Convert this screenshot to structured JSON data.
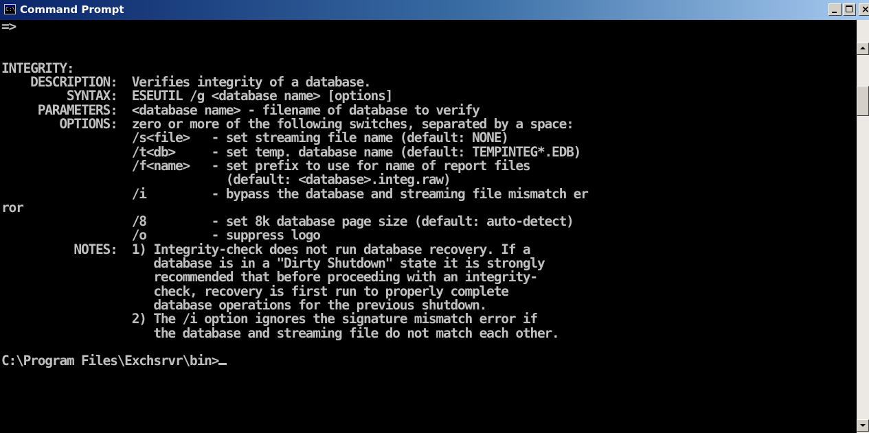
{
  "window": {
    "title": "Command Prompt",
    "icon": "command-prompt-icon",
    "icon_text": "C:\\",
    "controls": {
      "minimize": "minimize-icon",
      "maximize": "maximize-icon",
      "close": "close-icon",
      "close_glyph": "×"
    }
  },
  "colors": {
    "background": "#000000",
    "text": "#c0c0c0",
    "titlebar_start": "#0a246a",
    "titlebar_end": "#a6caf0"
  },
  "console": {
    "lines": [
      "=>",
      "",
      "",
      "INTEGRITY:",
      "    DESCRIPTION:  Verifies integrity of a database.",
      "         SYNTAX:  ESEUTIL /g <database name> [options]",
      "     PARAMETERS:  <database name> - filename of database to verify",
      "        OPTIONS:  zero or more of the following switches, separated by a space:",
      "                  /s<file>   - set streaming file name (default: NONE)",
      "                  /t<db>     - set temp. database name (default: TEMPINTEG*.EDB)",
      "                  /f<name>   - set prefix to use for name of report files",
      "                               (default: <database>.integ.raw)",
      "                  /i         - bypass the database and streaming file mismatch er",
      "ror",
      "                  /8         - set 8k database page size (default: auto-detect)",
      "                  /o         - suppress logo",
      "          NOTES:  1) Integrity-check does not run database recovery. If a",
      "                     database is in a \"Dirty Shutdown\" state it is strongly",
      "                     recommended that before proceeding with an integrity-",
      "                     check, recovery is first run to properly complete",
      "                     database operations for the previous shutdown.",
      "                  2) The /i option ignores the signature mismatch error if",
      "                     the database and streaming file do not match each other.",
      ""
    ],
    "prompt": "C:\\Program Files\\Exchsrvr\\bin>"
  },
  "scrollbar": {
    "up": "scroll-up-arrow-icon",
    "down": "scroll-down-arrow-icon"
  }
}
